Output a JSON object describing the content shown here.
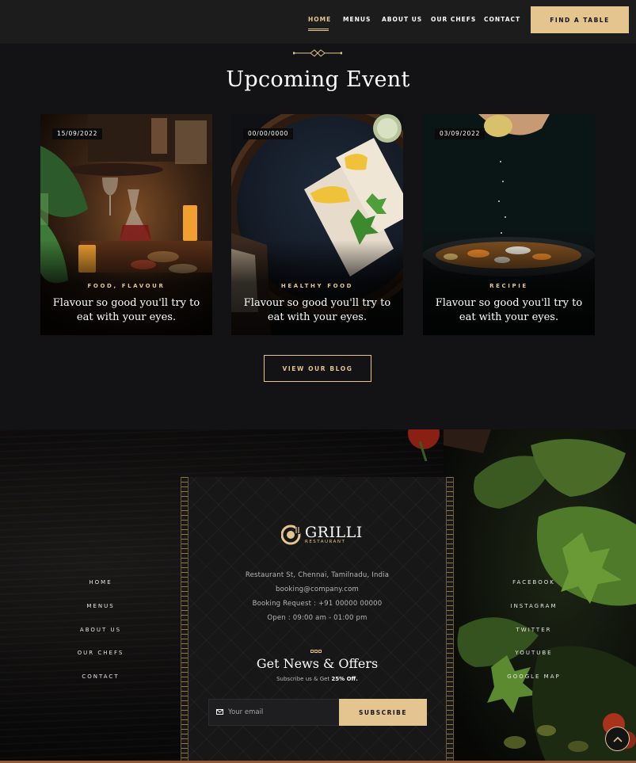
{
  "nav": {
    "items": [
      {
        "label": "HOME",
        "active": true
      },
      {
        "label": "MENUS"
      },
      {
        "label": "ABOUT US"
      },
      {
        "label": "OUR CHEFS"
      },
      {
        "label": "CONTACT"
      }
    ],
    "cta_label": "FIND A TABLE"
  },
  "events": {
    "title": "Upcoming Event",
    "cards": [
      {
        "date": "15/09/2022",
        "category": "FOOD, FLAVOUR",
        "text": "Flavour so good you'll try to eat with your eyes.",
        "image_icon": "restaurant-table-photo"
      },
      {
        "date": "00/00/0000",
        "category": "HEALTHY FOOD",
        "text": "Flavour so good you'll try to eat with your eyes.",
        "image_icon": "wraps-plate-photo"
      },
      {
        "date": "03/09/2022",
        "category": "RECIPIE",
        "text": "Flavour so good you'll try to eat with your eyes.",
        "image_icon": "soup-bowl-photo"
      }
    ],
    "button_label": "VIEW OUR BLOG"
  },
  "footer": {
    "brand": {
      "name": "GRILLI",
      "tagline": "RESTAURANT"
    },
    "address": "Restaurant St, Chennai, Tamilnadu, India",
    "email": "booking@company.com",
    "booking": "Booking Request : +91 00000 00000",
    "hours": "Open : 09:00 am - 01:00 pm",
    "news_title": "Get News & Offers",
    "news_sub_prefix": "Subscribe us & Get ",
    "news_sub_highlight": "25% Off.",
    "email_placeholder": "Your email",
    "subscribe_label": "SUBSCRIBE",
    "left_links": [
      "HOME",
      "MENUS",
      "ABOUT US",
      "OUR CHEFS",
      "CONTACT"
    ],
    "right_links": [
      "FACEBOOK",
      "INSTAGRAM",
      "TWITTER",
      "YOUTUBE",
      "GOOGLE MAP"
    ]
  },
  "colors": {
    "accent": "#e4c590",
    "header_bg": "#1c1c1d",
    "section_bg": "#131214"
  }
}
